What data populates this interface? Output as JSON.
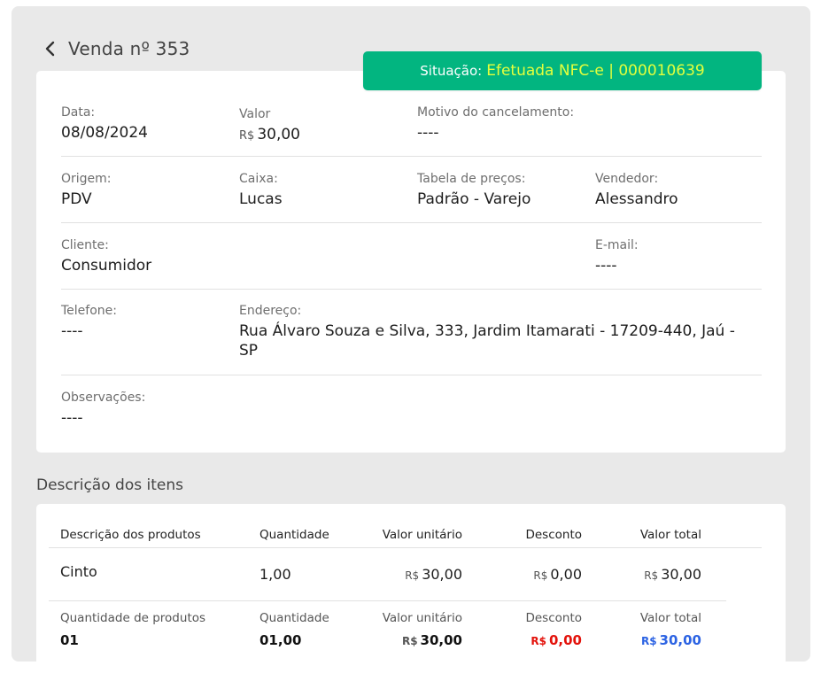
{
  "header": {
    "title": "Venda nº 353"
  },
  "status": {
    "label": "Situação:",
    "value": "Efetuada NFC-e | 000010639"
  },
  "currency": "R$",
  "details": {
    "data": {
      "label": "Data:",
      "value": "08/08/2024"
    },
    "valor": {
      "label": "Valor",
      "value": "30,00"
    },
    "motivo": {
      "label": "Motivo do cancelamento:",
      "value": "----"
    },
    "origem": {
      "label": "Origem:",
      "value": "PDV"
    },
    "caixa": {
      "label": "Caixa:",
      "value": "Lucas"
    },
    "tabela": {
      "label": "Tabela de preços:",
      "value": "Padrão - Varejo"
    },
    "vendedor": {
      "label": "Vendedor:",
      "value": "Alessandro"
    },
    "cliente": {
      "label": "Cliente:",
      "value": "Consumidor"
    },
    "email": {
      "label": "E-mail:",
      "value": "----"
    },
    "telefone": {
      "label": "Telefone:",
      "value": "----"
    },
    "endereco": {
      "label": "Endereço:",
      "value": "Rua Álvaro Souza e Silva, 333, Jardim Itamarati - 17209-440, Jaú - SP"
    },
    "observacoes": {
      "label": "Observações:",
      "value": "----"
    }
  },
  "items": {
    "section_title": "Descrição dos itens",
    "columns": [
      "Descrição dos produtos",
      "Quantidade",
      "Valor unitário",
      "Desconto",
      "Valor total"
    ],
    "rows": [
      {
        "produto": "Cinto",
        "quantidade": "1,00",
        "valor_unitario": "30,00",
        "desconto": "0,00",
        "valor_total": "30,00"
      }
    ],
    "totals": {
      "labels": [
        "Quantidade de produtos",
        "Quantidade",
        "Valor unitário",
        "Desconto",
        "Valor total"
      ],
      "quantidade_produtos": "01",
      "quantidade": "01,00",
      "valor_unitario": "30,00",
      "desconto": "0,00",
      "valor_total": "30,00"
    }
  }
}
